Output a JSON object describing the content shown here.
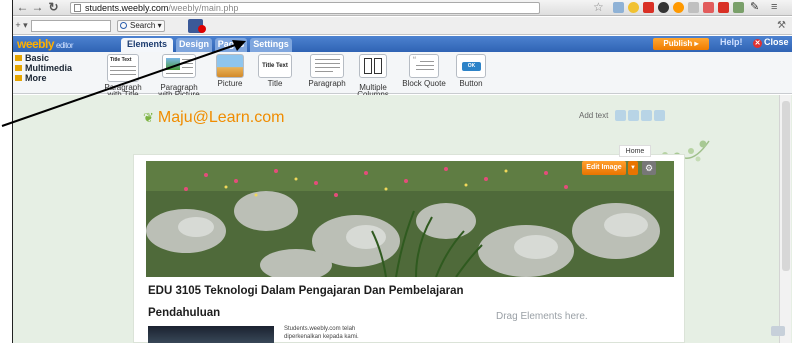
{
  "browser": {
    "url_host": "students.weebly.com",
    "url_path": "/weebly/main.php",
    "search_button": "Search"
  },
  "editor": {
    "logo": "weebly",
    "logo_sub": "editor",
    "tabs": [
      {
        "label": "Elements",
        "active": true
      },
      {
        "label": "Design",
        "active": false
      },
      {
        "label": "Pages",
        "active": false
      },
      {
        "label": "Settings",
        "active": false
      }
    ],
    "publish": "Publish",
    "help": "Help!",
    "close": "Close"
  },
  "palette": {
    "categories": [
      "Basic",
      "Multimedia",
      "More"
    ],
    "items": [
      {
        "label": "Paragraph\nwith Title",
        "thumb_text": "Title Text"
      },
      {
        "label": "Paragraph\nwith Picture",
        "thumb_text": ""
      },
      {
        "label": "Picture",
        "thumb_text": ""
      },
      {
        "label": "Title",
        "thumb_text": "Title Text"
      },
      {
        "label": "Paragraph",
        "thumb_text": ""
      },
      {
        "label": "Multiple\nColumns",
        "thumb_text": ""
      },
      {
        "label": "Block Quote",
        "thumb_text": ""
      },
      {
        "label": "Button",
        "thumb_text": "OK"
      }
    ]
  },
  "site": {
    "title": "Maju@Learn.com",
    "add_text": "Add text",
    "nav_home": "Home",
    "edit_image": "Edit Image",
    "heading": "EDU 3105 Teknologi Dalam Pengajaran Dan Pembelajaran",
    "subheading": "Pendahuluan",
    "body_text": "Students.weebly.com telah diperkenalkan kepada kami.",
    "drag_hint": "Drag Elements here."
  },
  "colors": {
    "accent_orange": "#ef7c00",
    "editor_blue": "#2f63b4",
    "site_title": "#f08c00"
  }
}
